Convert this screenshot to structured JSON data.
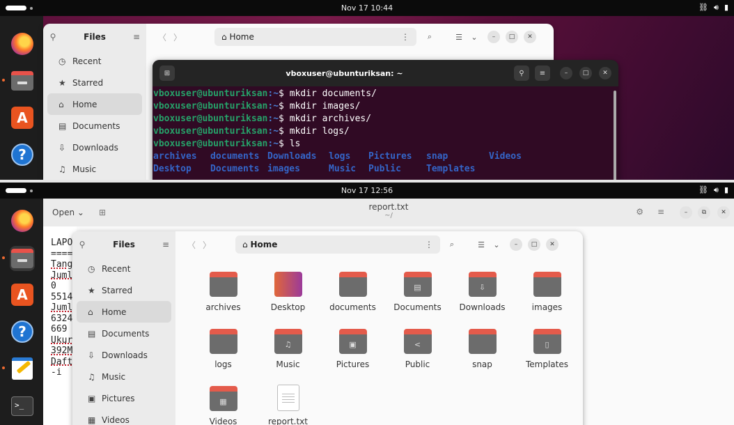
{
  "panel1": {
    "clock": "Nov 17  10:44",
    "files": {
      "sidebar_title": "Files",
      "path": "Home",
      "sidebar": [
        {
          "icon": "clock-icon",
          "glyph": "◷",
          "label": "Recent"
        },
        {
          "icon": "star-icon",
          "glyph": "★",
          "label": "Starred"
        },
        {
          "icon": "home-icon",
          "glyph": "⌂",
          "label": "Home"
        },
        {
          "icon": "document-icon",
          "glyph": "▤",
          "label": "Documents"
        },
        {
          "icon": "download-icon",
          "glyph": "⇩",
          "label": "Downloads"
        },
        {
          "icon": "music-icon",
          "glyph": "♫",
          "label": "Music"
        }
      ]
    },
    "terminal": {
      "title": "vboxuser@ubunturiksan: ~",
      "prompt": "vboxuser@ubunturiksan",
      "path": ":~",
      "dollar": "$ ",
      "commands": [
        "mkdir documents/",
        "mkdir images/",
        "mkdir archives/",
        "mkdir logs/",
        "ls"
      ],
      "ls_rows": [
        [
          "archives",
          "documents",
          "Downloads",
          "logs",
          "Pictures",
          "snap",
          "Videos"
        ],
        [
          "Desktop",
          "Documents",
          "images",
          "Music",
          "Public",
          "Templates",
          ""
        ]
      ]
    }
  },
  "panel2": {
    "clock": "Nov 17  12:56",
    "editor": {
      "open_label": "Open",
      "title": "report.txt",
      "subtitle": "~/",
      "lines": [
        "LAPO",
        "====",
        "Tang",
        "Juml",
        "0",
        "5514",
        "Juml",
        "6324",
        "669",
        "Ukur",
        "392M",
        "Daft",
        "-i"
      ]
    },
    "files": {
      "sidebar_title": "Files",
      "path": "Home",
      "sidebar": [
        {
          "icon": "clock-icon",
          "glyph": "◷",
          "label": "Recent"
        },
        {
          "icon": "star-icon",
          "glyph": "★",
          "label": "Starred"
        },
        {
          "icon": "home-icon",
          "glyph": "⌂",
          "label": "Home"
        },
        {
          "icon": "document-icon",
          "glyph": "▤",
          "label": "Documents"
        },
        {
          "icon": "download-icon",
          "glyph": "⇩",
          "label": "Downloads"
        },
        {
          "icon": "music-icon",
          "glyph": "♫",
          "label": "Music"
        },
        {
          "icon": "picture-icon",
          "glyph": "▣",
          "label": "Pictures"
        },
        {
          "icon": "video-icon",
          "glyph": "▦",
          "label": "Videos"
        }
      ],
      "items": [
        {
          "label": "archives",
          "kind": "folder",
          "glyph": ""
        },
        {
          "label": "Desktop",
          "kind": "desktop",
          "glyph": ""
        },
        {
          "label": "documents",
          "kind": "folder",
          "glyph": ""
        },
        {
          "label": "Documents",
          "kind": "folder",
          "glyph": "▤"
        },
        {
          "label": "Downloads",
          "kind": "folder",
          "glyph": "⇩"
        },
        {
          "label": "images",
          "kind": "folder",
          "glyph": ""
        },
        {
          "label": "logs",
          "kind": "folder",
          "glyph": ""
        },
        {
          "label": "Music",
          "kind": "folder",
          "glyph": "♫"
        },
        {
          "label": "Pictures",
          "kind": "folder",
          "glyph": "▣"
        },
        {
          "label": "Public",
          "kind": "folder",
          "glyph": "<"
        },
        {
          "label": "snap",
          "kind": "folder",
          "glyph": ""
        },
        {
          "label": "Templates",
          "kind": "folder",
          "glyph": "▯"
        },
        {
          "label": "Videos",
          "kind": "folder",
          "glyph": "▦"
        },
        {
          "label": "report.txt",
          "kind": "doc",
          "glyph": ""
        }
      ]
    }
  },
  "colors": {
    "accent": "#e95420",
    "terminal_bg": "#300a24",
    "prompt": "#26a269",
    "ls_dir": "#3465c8"
  }
}
